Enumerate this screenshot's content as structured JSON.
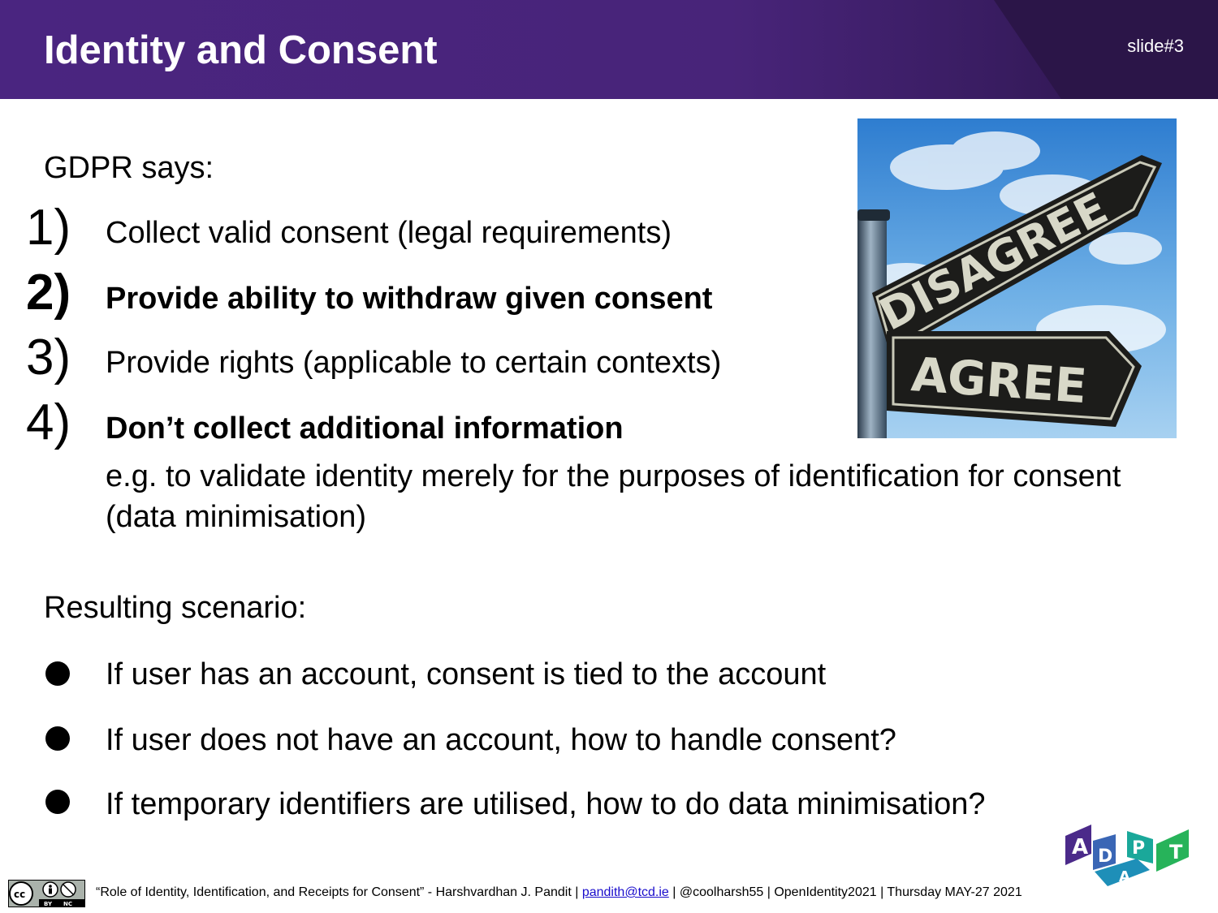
{
  "header": {
    "title": "Identity and Consent",
    "slide_number": "slide#3"
  },
  "intro": "GDPR says:",
  "requirements": [
    {
      "num": "1)",
      "text": "Collect valid consent (legal requirements)"
    },
    {
      "num": "2)",
      "text": "Provide ability to withdraw given consent"
    },
    {
      "num": "3)",
      "text": "Provide rights (applicable to certain contexts)"
    },
    {
      "num": "4)",
      "text": "Don’t collect additional information"
    }
  ],
  "requirement_4_detail": "e.g. to validate identity merely for the purposes of identification for consent (data minimisation)",
  "image": {
    "sign_disagree": "DISAGREE",
    "sign_agree": "AGREE"
  },
  "resulting_label": "Resulting scenario:",
  "scenarios": [
    "If user has an account, consent is tied to the account",
    "If user does not have an account, how to handle consent?",
    "If temporary identifiers are utilised, how to do data minimisation?"
  ],
  "logo": {
    "letters": [
      "A",
      "D",
      "A",
      "P",
      "T"
    ],
    "colors": [
      "#4b2a8a",
      "#3a66b5",
      "#1e8fb8",
      "#1aa89a",
      "#27b35a"
    ]
  },
  "license": {
    "cc": "cc",
    "by": "BY",
    "nc": "NC"
  },
  "footer": {
    "prefix": "“Role of Identity, Identification, and Receipts for Consent” - Harshvardhan J. Pandit | ",
    "email": "pandith@tcd.ie",
    "suffix": " | @coolharsh55 | OpenIdentity2021 | Thursday MAY-27 2021"
  },
  "colors": {
    "header": "#482479",
    "header_dark": "#2b1548",
    "link": "#1a0dcc"
  }
}
